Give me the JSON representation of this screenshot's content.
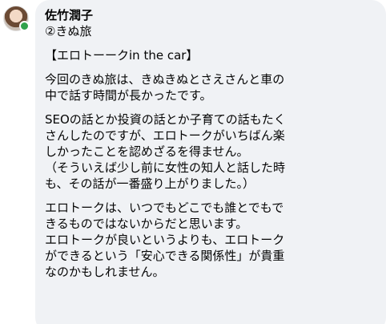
{
  "post": {
    "author": "佐竹潤子",
    "tag": "②きぬ旅",
    "paragraphs": [
      "【エロトーークin the car】",
      "今回のきぬ旅は、きぬきぬとさえさんと車の\n中で話す時間が長かったです。",
      "SEOの話とか投資の話とか子育ての話もたく\nさんしたのですが、エロトークがいちばん楽\nしかったことを認めざるを得ません。\n（そういえば少し前に女性の知人と話した時\nも、その話が一番盛り上がりました。）",
      "エロトークは、いつでもどこでも誰とでもで\nきるものではないからだと思います。\nエロトークが良いというよりも、エロトーク\nができるという「安心できる関係性」が貴重\nなのかもしれません。"
    ]
  },
  "colors": {
    "bubble_bg": "#f0f2f5",
    "text": "#050505",
    "online": "#31a24c"
  }
}
